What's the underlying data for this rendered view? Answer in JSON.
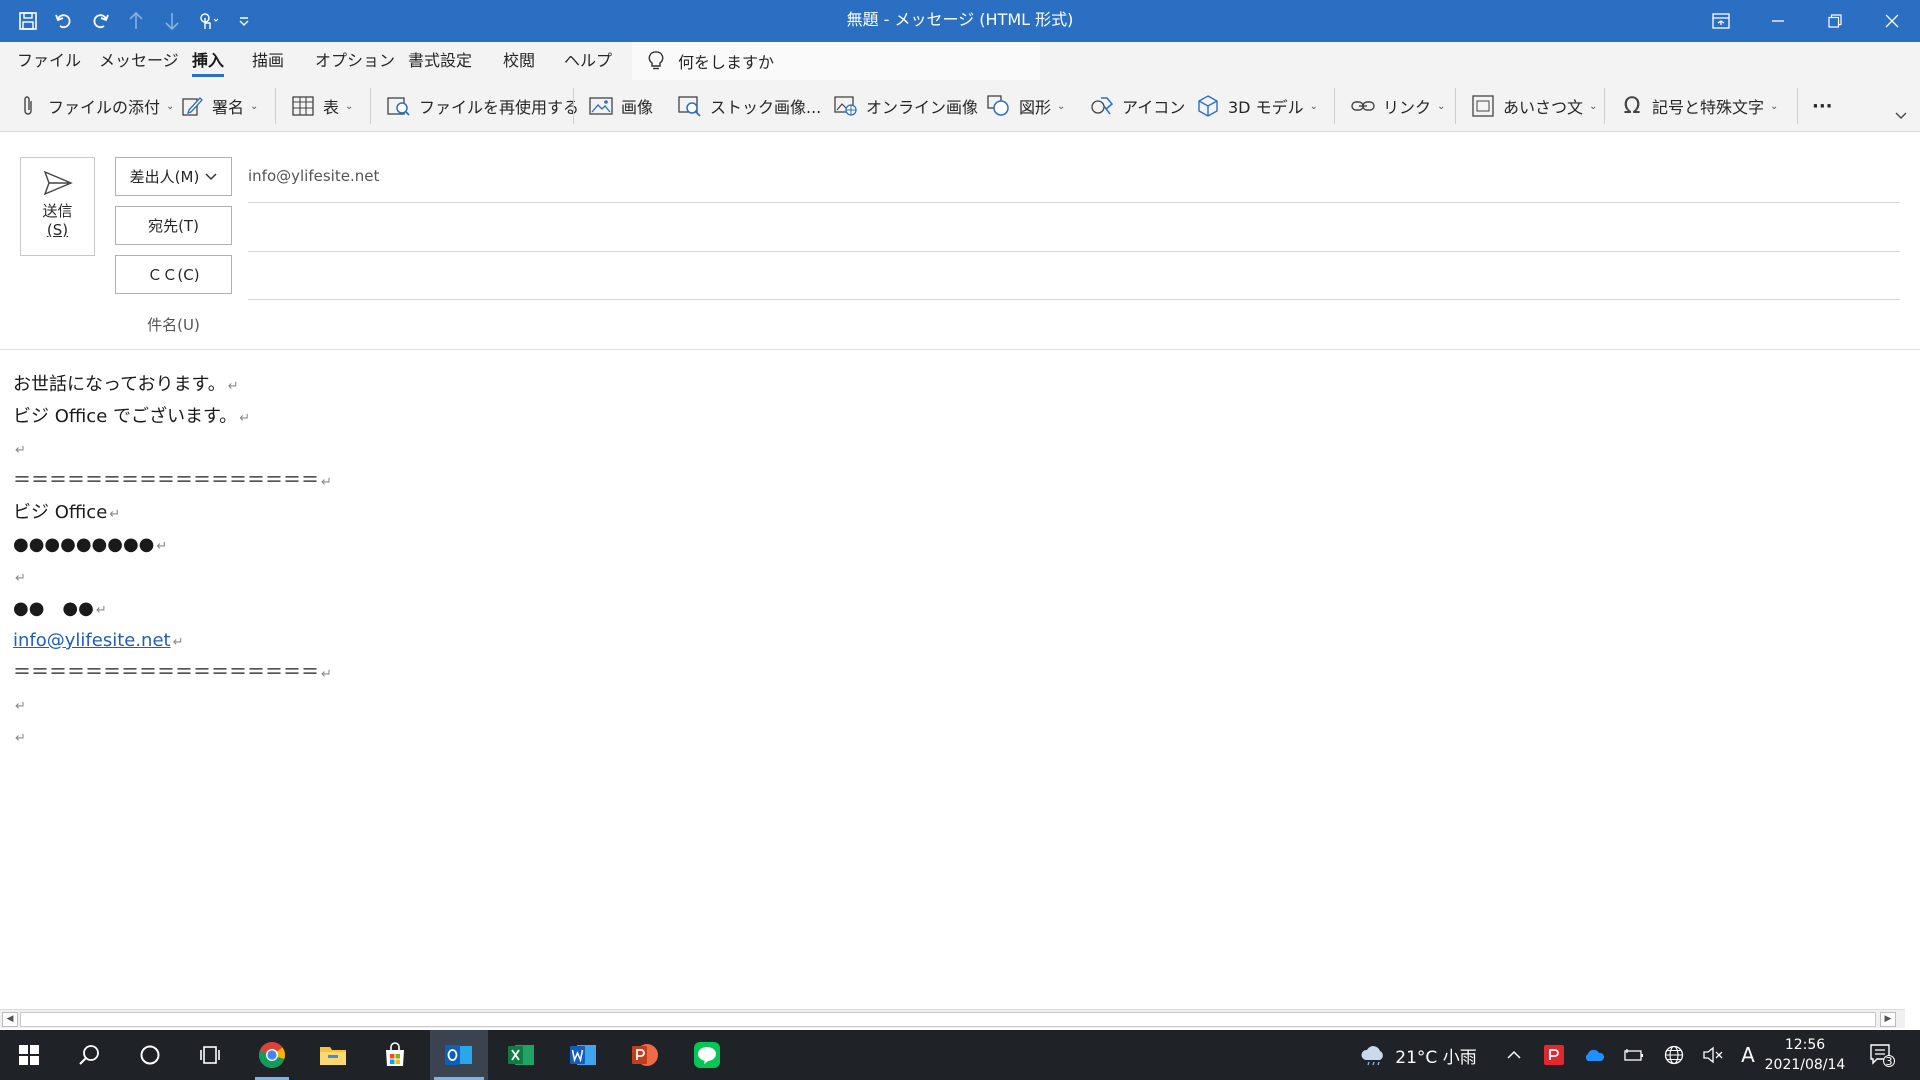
{
  "window": {
    "title": "無題 - メッセージ (HTML 形式)"
  },
  "menu_tabs": [
    "ファイル",
    "メッセージ",
    "挿入",
    "描画",
    "オプション",
    "書式設定",
    "校閲",
    "ヘルプ"
  ],
  "active_tab": "挿入",
  "tell_me": "何をしますか",
  "ribbon": {
    "attach": "ファイルの添付",
    "signature": "署名",
    "table": "表",
    "reuse": "ファイルを再使用する",
    "picture": "画像",
    "stock": "ストック画像...",
    "online": "オンライン画像",
    "shapes": "図形",
    "icons": "アイコン",
    "model3d": "3D モデル",
    "link": "リンク",
    "greeting": "あいさつ文",
    "symbols": "記号と特殊文字",
    "more": "···"
  },
  "compose": {
    "send_label": "送信",
    "send_key": "(S)",
    "from_label": "差出人(M)",
    "from_value": "info@ylifesite.net",
    "to_label": "宛先(T)",
    "to_value": "",
    "cc_label": "ＣＣ(C)",
    "cc_value": "",
    "subject_label": "件名(U)",
    "subject_value": ""
  },
  "body": {
    "line1": "お世話になっております。",
    "line2": "ビジ Office でございます。",
    "line3": "",
    "sep1": "＝＝＝＝＝＝＝＝＝＝＝＝＝＝＝＝＝",
    "company": "ビジ Office",
    "address": "●●●●●●●●●",
    "line7": "",
    "name": "●●　●●",
    "email": "info@ylifesite.net",
    "sep2": "＝＝＝＝＝＝＝＝＝＝＝＝＝＝＝＝＝",
    "line11": "",
    "line12": "",
    "para_mark": "↵"
  },
  "taskbar": {
    "weather": "21°C 小雨",
    "ime": "A",
    "time": "12:56",
    "date": "2021/08/14",
    "notifications": "3",
    "apps": [
      "start-icon",
      "search-icon",
      "cortana-icon",
      "task-view-icon",
      "chrome-icon",
      "file-explorer-icon",
      "store-icon",
      "outlook-icon",
      "excel-icon",
      "word-icon",
      "powerpoint-icon",
      "line-icon"
    ]
  },
  "colors": {
    "titlebar": "#2b6fc2",
    "accent": "#2b6fc2",
    "taskbar": "#1f2327",
    "link": "#1f5fb8"
  }
}
